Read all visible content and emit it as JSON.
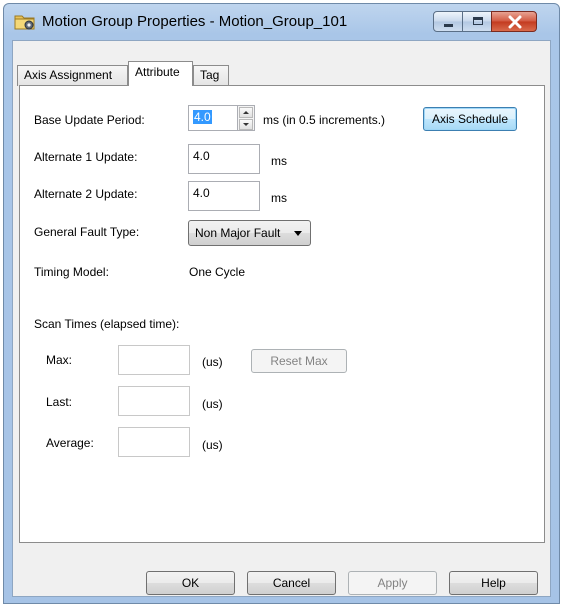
{
  "window": {
    "title": "Motion Group Properties - Motion_Group_101",
    "icon": "folder-gear-icon"
  },
  "tabs": [
    {
      "label": "Axis Assignment",
      "active": false
    },
    {
      "label": "Attribute",
      "active": true
    },
    {
      "label": "Tag",
      "active": false
    }
  ],
  "attribute": {
    "base_update_label": "Base Update Period:",
    "base_update_value": "4.0",
    "base_update_unit": "ms (in 0.5 increments.)",
    "axis_schedule_button": "Axis Schedule",
    "alt1_label": "Alternate 1 Update:",
    "alt1_value": "4.0",
    "alt1_unit": "ms",
    "alt2_label": "Alternate 2 Update:",
    "alt2_value": "4.0",
    "alt2_unit": "ms",
    "fault_label": "General Fault Type:",
    "fault_value": "Non Major Fault",
    "timing_label": "Timing Model:",
    "timing_value": "One Cycle",
    "scan_times_label": "Scan Times (elapsed time):",
    "max_label": "Max:",
    "max_unit": "(us)",
    "reset_max_button": "Reset Max",
    "last_label": "Last:",
    "last_unit": "(us)",
    "average_label": "Average:",
    "average_unit": "(us)"
  },
  "buttons": {
    "ok": "OK",
    "cancel": "Cancel",
    "apply": "Apply",
    "help": "Help"
  },
  "colors": {
    "title_bar": "#a9c6e8",
    "close_button": "#c33a1f",
    "focus_button": "#bee6fd",
    "selection": "#3399ff"
  }
}
